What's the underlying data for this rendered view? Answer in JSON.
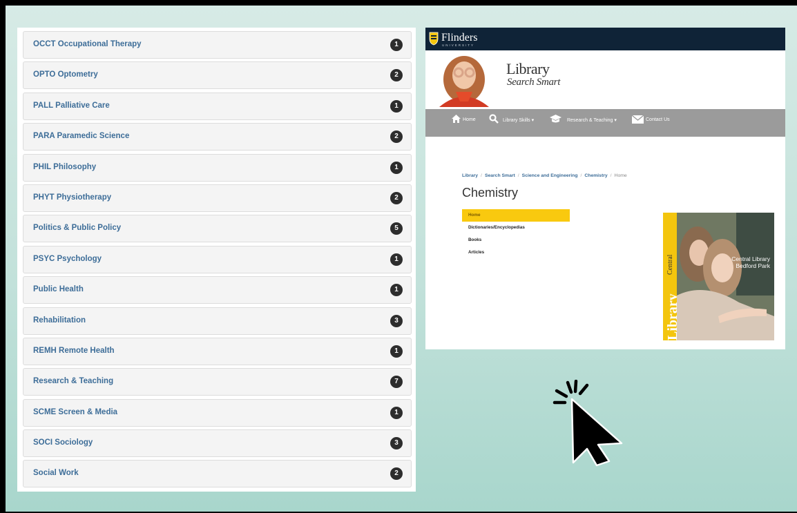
{
  "subjects": [
    {
      "label": "OCCT Occupational Therapy",
      "count": "1"
    },
    {
      "label": "OPTO Optometry",
      "count": "2"
    },
    {
      "label": "PALL Palliative Care",
      "count": "1"
    },
    {
      "label": "PARA Paramedic Science",
      "count": "2"
    },
    {
      "label": "PHIL Philosophy",
      "count": "1"
    },
    {
      "label": "PHYT Physiotherapy",
      "count": "2"
    },
    {
      "label": "Politics & Public Policy",
      "count": "5"
    },
    {
      "label": "PSYC Psychology",
      "count": "1"
    },
    {
      "label": "Public Health",
      "count": "1"
    },
    {
      "label": "Rehabilitation",
      "count": "3"
    },
    {
      "label": "REMH Remote Health",
      "count": "1"
    },
    {
      "label": "Research & Teaching",
      "count": "7"
    },
    {
      "label": "SCME Screen & Media",
      "count": "1"
    },
    {
      "label": "SOCI Sociology",
      "count": "3"
    },
    {
      "label": "Social Work",
      "count": "2"
    }
  ],
  "site": {
    "brand": "Flinders",
    "brand_sub": "UNIVERSITY",
    "library_title": "Library",
    "library_sub": "Search Smart",
    "nav": {
      "home": "Home",
      "skills": "Library Skills",
      "research": "Research & Teaching",
      "contact": "Contact Us"
    },
    "breadcrumb": [
      "Library",
      "Search Smart",
      "Science and Engineering",
      "Chemistry",
      "Home"
    ],
    "page_title": "Chemistry",
    "side_menu": [
      "Home",
      "Dictionaries/Encyclopedias",
      "Books",
      "Articles"
    ],
    "photo_word_small": "Central",
    "photo_word_large": "Library",
    "photo_caption_1": "Central Library",
    "photo_caption_2": "Bedford Park"
  },
  "colors": {
    "link": "#3d6d98",
    "badge": "#2d2d2d",
    "accent_yellow": "#f9c90f",
    "topbar": "#0f2337",
    "navbar": "#9b9b9b"
  },
  "icons": [
    "home-icon",
    "search-icon",
    "graduation-cap-icon",
    "envelope-icon",
    "click-cursor-icon"
  ]
}
